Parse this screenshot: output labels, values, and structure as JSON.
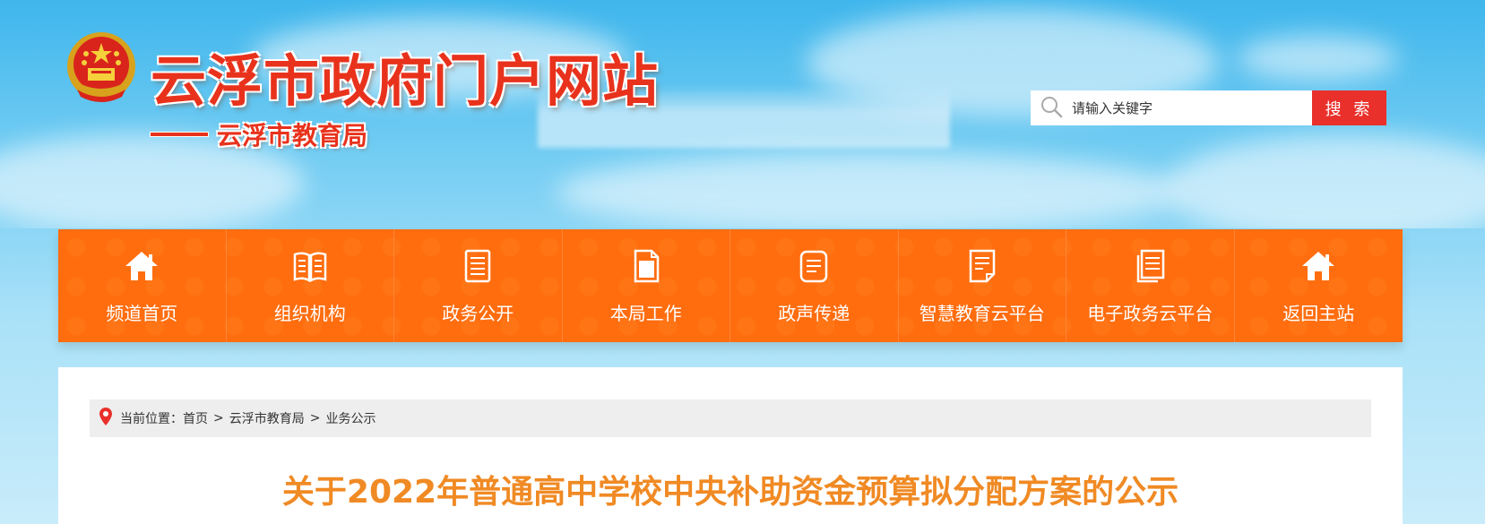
{
  "header": {
    "site_title": "云浮市政府门户网站",
    "sub_title": "云浮市教育局",
    "emblem_icon": "national-emblem-icon",
    "search": {
      "placeholder": "请输入关键字",
      "button_label": "搜 索",
      "icon": "search-icon"
    }
  },
  "nav": {
    "items": [
      {
        "label": "频道首页",
        "icon": "home-icon"
      },
      {
        "label": "组织机构",
        "icon": "book-icon"
      },
      {
        "label": "政务公开",
        "icon": "document-list-icon"
      },
      {
        "label": "本局工作",
        "icon": "clipboard-icon"
      },
      {
        "label": "政声传递",
        "icon": "notes-icon"
      },
      {
        "label": "智慧教育云平台",
        "icon": "file-edit-icon"
      },
      {
        "label": "电子政务云平台",
        "icon": "stacked-documents-icon"
      },
      {
        "label": "返回主站",
        "icon": "home-icon"
      }
    ]
  },
  "breadcrumb": {
    "prefix": "当前位置：",
    "items": [
      "首页",
      "云浮市教育局",
      "业务公示"
    ],
    "separator": ">",
    "icon": "location-pin-icon"
  },
  "article": {
    "title": "关于2022年普通高中学校中央补助资金预算拟分配方案的公示"
  },
  "colors": {
    "nav_bg": "#ff6d0f",
    "accent_red": "#e8321c",
    "search_button": "#e9302b",
    "title_orange": "#f08a24"
  }
}
